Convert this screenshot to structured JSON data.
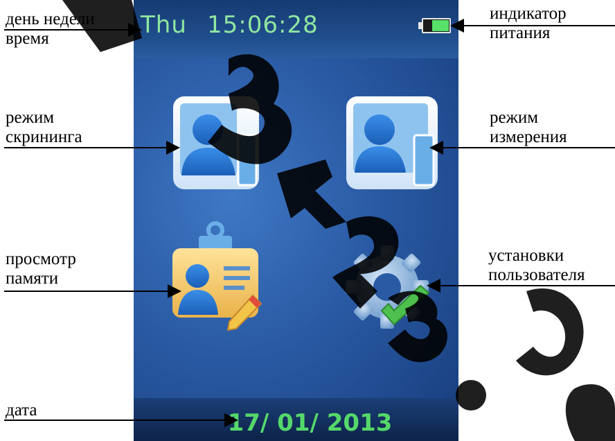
{
  "device": {
    "status": {
      "day": "Thu",
      "time": "15:06:28",
      "battery_level": 0.7
    },
    "date": "17/ 01/ 2013",
    "icons": {
      "screening": "screening-mode-icon",
      "measurement": "measurement-mode-icon",
      "memory": "memory-view-icon",
      "settings": "user-settings-icon"
    },
    "colors": {
      "screen_blue": "#2a5aa4",
      "status_text": "#8fe6a0",
      "date_text": "#55d86a"
    }
  },
  "annotations": {
    "day_time": {
      "line1": "день недели",
      "line2": "время"
    },
    "power": {
      "line1": "индикатор",
      "line2": "питания"
    },
    "screening": {
      "line1": "режим",
      "line2": "скрининга"
    },
    "measurement": {
      "line1": "режим",
      "line2": "измерения"
    },
    "memory": {
      "line1": "просмотр",
      "line2": "памяти"
    },
    "settings": {
      "line1": "установки",
      "line2": "пользователя"
    },
    "date": {
      "line1": "дата"
    }
  }
}
